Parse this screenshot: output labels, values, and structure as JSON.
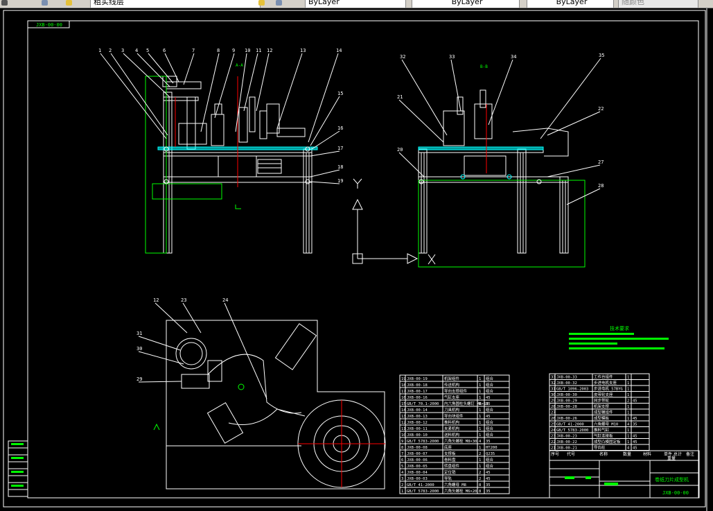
{
  "toolbar": {
    "layer_name": "粗实线层",
    "color": "ByLayer",
    "linetype": "ByLayer",
    "lineweight": "ByLayer",
    "plot_style": "随颜色"
  },
  "drawing": {
    "frame_tag": "JXB-00-00",
    "view_labels": {
      "a": "A-A",
      "b": "B-B"
    },
    "ucs": {
      "y": "Y",
      "x": "X"
    },
    "balloons_front": [
      "1",
      "2",
      "3",
      "4",
      "5",
      "6",
      "7",
      "8",
      "9",
      "10",
      "11",
      "12",
      "13",
      "14",
      "15",
      "16",
      "17",
      "18",
      "19"
    ],
    "balloons_side": [
      "32",
      "33",
      "34",
      "35",
      "21",
      "22",
      "20",
      "27",
      "28"
    ],
    "balloons_top": [
      "12",
      "23",
      "24",
      "31",
      "30",
      "29"
    ],
    "tech_title": "技术要求",
    "parts_left": [
      [
        "19",
        "JXB-00-19",
        "机架组件",
        "1",
        "组合"
      ],
      [
        "18",
        "JXB-00-18",
        "传送机构",
        "1",
        "组合"
      ],
      [
        "17",
        "JXB-00-17",
        "导向支撑组件",
        "1",
        "组合"
      ],
      [
        "16",
        "JXB-00-16",
        "气缸支座",
        "1",
        "45"
      ],
      [
        "15",
        "GB/T 70.1-2000",
        "内六角圆柱头螺钉 M6×16",
        "8",
        "35"
      ],
      [
        "14",
        "JXB-00-14",
        "刀具机构",
        "1",
        "组合"
      ],
      [
        "13",
        "JXB-00-13",
        "导向块组件",
        "1",
        "45"
      ],
      [
        "12",
        "JXB-00-12",
        "推料机构",
        "1",
        "组合"
      ],
      [
        "11",
        "JXB-00-11",
        "夹紧机构",
        "1",
        "组合"
      ],
      [
        "10",
        "JXB-00-10",
        "送料机构",
        "1",
        "组合"
      ],
      [
        "9",
        "GB/T 5783-2000",
        "六角头螺栓 M8×30",
        "4",
        "35"
      ],
      [
        "8",
        "JXB-00-08",
        "底座",
        "1",
        "HT200"
      ],
      [
        "7",
        "JXB-00-07",
        "支撑板",
        "2",
        "Q235"
      ],
      [
        "6",
        "JXB-00-06",
        "卷料盘",
        "1",
        "组合"
      ],
      [
        "5",
        "JXB-00-05",
        "转盘组件",
        "1",
        "组合"
      ],
      [
        "4",
        "JXB-00-04",
        "定位销",
        "2",
        "45"
      ],
      [
        "3",
        "JXB-00-03",
        "导轨",
        "2",
        "45"
      ],
      [
        "2",
        "GB/T 41-2000",
        "六角螺母 M8",
        "8",
        "35"
      ],
      [
        "1",
        "GB/T 5783-2000",
        "六角头螺栓 M6×20",
        "8",
        "35"
      ]
    ],
    "parts_right": [
      [
        "33",
        "JXB-00-33",
        "工作台组件",
        "1",
        ""
      ],
      [
        "32",
        "JXB-00-32",
        "步进电机支座",
        "1",
        ""
      ],
      [
        "31",
        "GB/T 1096-2003",
        "步进电机 57BYG",
        "1",
        ""
      ],
      [
        "30",
        "JXB-00-30",
        "皮带轮支座",
        "1",
        ""
      ],
      [
        "29",
        "JXB-00-29",
        "同步带轮",
        "2",
        "45"
      ],
      [
        "28",
        "JXB-00-28",
        "机架支撑",
        "1",
        ""
      ],
      [
        "27",
        "",
        "成型模组件",
        "1",
        ""
      ],
      [
        "26",
        "JXB-00-26",
        "成型模板",
        "1",
        "45"
      ],
      [
        "25",
        "GB/T 41-2000",
        "六角螺母 M10",
        "4",
        "35"
      ],
      [
        "24",
        "GB/T 5783-2000",
        "推料气缸",
        "1",
        ""
      ],
      [
        "23",
        "JXB-00-23",
        "气缸连接板",
        "1",
        "45"
      ],
      [
        "22",
        "JXB-00-22",
        "成型凸模固定板",
        "1",
        "45"
      ],
      [
        "21",
        "JXB-00-21",
        "导向柱",
        "4",
        "45"
      ]
    ],
    "parts_header": {
      "no": "序号",
      "code": "代号",
      "name": "名称",
      "qty": "数量",
      "material": "材料",
      "unit": "单件",
      "total": "总计",
      "weight": "重量",
      "remark": "备注"
    },
    "title_name": "卷纸刀片成型机",
    "title_code": "JXB-00-00"
  },
  "colors": {
    "bg": "#000000",
    "line": "#ffffff",
    "accent": "#00ff00",
    "cyan": "#00ffff",
    "red": "#ff0000"
  }
}
